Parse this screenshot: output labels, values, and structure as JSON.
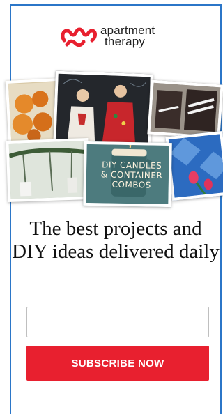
{
  "brand": {
    "line1": "apartment",
    "line2": "therapy",
    "logo_icon": "apartment-therapy-logo-icon",
    "accent": "#e8202f"
  },
  "collage": {
    "candle_caption": "DIY CANDLES & CONTAINER COMBOS"
  },
  "headline": "The best projects and DIY ideas delivered daily",
  "signup": {
    "email_value": "",
    "button_label": "SUBSCRIBE NOW",
    "button_color": "#e8202f"
  },
  "frame": {
    "border_color": "#2b76c8"
  }
}
